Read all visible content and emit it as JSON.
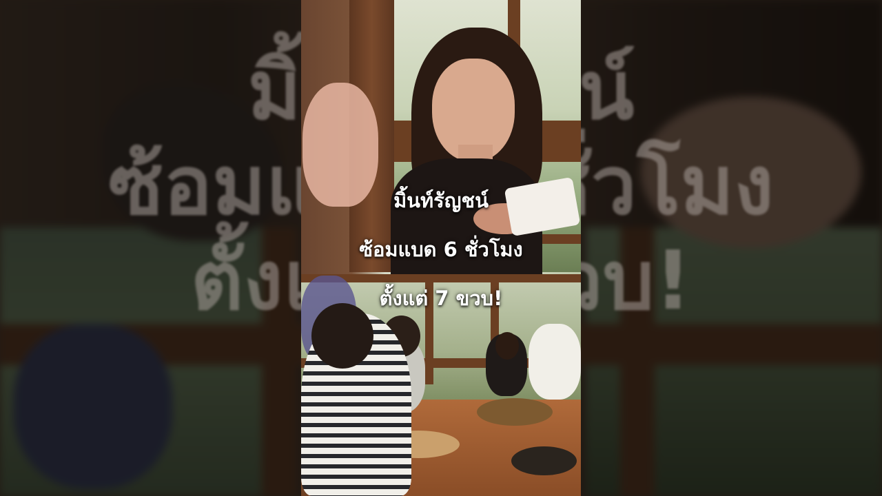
{
  "caption": {
    "line1": "มิ้นท์รัญชน์",
    "line2": "ซ้อมแบด 6 ชั่วโมง",
    "line3": "ตั้งแต่ 7 ขวบ!"
  }
}
